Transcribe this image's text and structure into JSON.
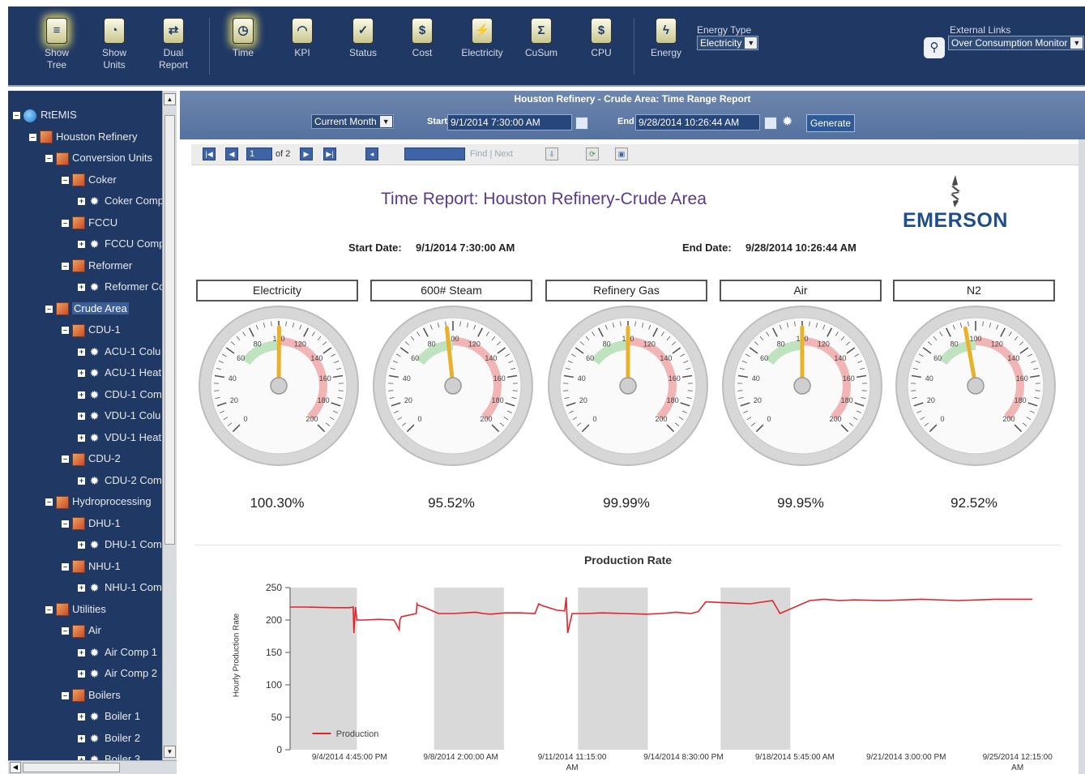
{
  "toolbar": {
    "buttons": [
      {
        "label1": "Show",
        "label2": "Tree",
        "icon": "tree-icon"
      },
      {
        "label1": "Show",
        "label2": "Units",
        "icon": "units-icon"
      },
      {
        "label1": "Dual",
        "label2": "Report",
        "icon": "dual-report-icon"
      },
      {
        "label1": "Time",
        "label2": "",
        "icon": "clock-icon"
      },
      {
        "label1": "KPI",
        "label2": "",
        "icon": "kpi-icon"
      },
      {
        "label1": "Status",
        "label2": "",
        "icon": "status-icon"
      },
      {
        "label1": "Cost",
        "label2": "",
        "icon": "dollar-icon"
      },
      {
        "label1": "Electricity",
        "label2": "",
        "icon": "plug-icon"
      },
      {
        "label1": "CuSum",
        "label2": "",
        "icon": "cusum-icon"
      },
      {
        "label1": "CPU",
        "label2": "",
        "icon": "cpu-icon"
      },
      {
        "label1": "Energy",
        "label2": "",
        "icon": "energy-icon"
      }
    ],
    "energy_type_label": "Energy Type",
    "energy_type_value": "Electricity",
    "external_links_label": "External Links",
    "external_links_value": "Over Consumption Monitor"
  },
  "tree": [
    {
      "label": "RtEMIS",
      "type": "globe",
      "toggle": "■"
    },
    {
      "label": "Houston Refinery",
      "type": "node",
      "toggle": "■"
    },
    {
      "label": "Conversion Units",
      "type": "node",
      "toggle": "■"
    },
    {
      "label": "Coker",
      "type": "node",
      "toggle": "■"
    },
    {
      "label": "Coker Comp",
      "type": "gear",
      "toggle": "+"
    },
    {
      "label": "FCCU",
      "type": "node",
      "toggle": "■"
    },
    {
      "label": "FCCU Comp",
      "type": "gear",
      "toggle": "+"
    },
    {
      "label": "Reformer",
      "type": "node",
      "toggle": "■"
    },
    {
      "label": "Reformer Co",
      "type": "gear",
      "toggle": "+"
    },
    {
      "label": "Crude Area",
      "type": "node",
      "toggle": "■",
      "selected": true
    },
    {
      "label": "CDU-1",
      "type": "node",
      "toggle": "■"
    },
    {
      "label": "ACU-1 Colu",
      "type": "gear",
      "toggle": "+"
    },
    {
      "label": "ACU-1 Heat",
      "type": "gear",
      "toggle": "+"
    },
    {
      "label": "CDU-1 Com",
      "type": "gear",
      "toggle": "+"
    },
    {
      "label": "VDU-1 Colu",
      "type": "gear",
      "toggle": "+"
    },
    {
      "label": "VDU-1 Heat",
      "type": "gear",
      "toggle": "+"
    },
    {
      "label": "CDU-2",
      "type": "node",
      "toggle": "■"
    },
    {
      "label": "CDU-2 Com",
      "type": "gear",
      "toggle": "+"
    },
    {
      "label": "Hydroprocessing",
      "type": "node",
      "toggle": "■"
    },
    {
      "label": "DHU-1",
      "type": "node",
      "toggle": "■"
    },
    {
      "label": "DHU-1 Com",
      "type": "gear",
      "toggle": "+"
    },
    {
      "label": "NHU-1",
      "type": "node",
      "toggle": "■"
    },
    {
      "label": "NHU-1 Com",
      "type": "gear",
      "toggle": "+"
    },
    {
      "label": "Utilities",
      "type": "node",
      "toggle": "■"
    },
    {
      "label": "Air",
      "type": "node",
      "toggle": "■"
    },
    {
      "label": "Air Comp 1",
      "type": "gear",
      "toggle": "+"
    },
    {
      "label": "Air Comp 2",
      "type": "gear",
      "toggle": "+"
    },
    {
      "label": "Boilers",
      "type": "node",
      "toggle": "■"
    },
    {
      "label": "Boiler 1",
      "type": "gear",
      "toggle": "+"
    },
    {
      "label": "Boiler 2",
      "type": "gear",
      "toggle": "+"
    },
    {
      "label": "Boiler 3",
      "type": "gear",
      "toggle": "+"
    }
  ],
  "header": {
    "report_title": "Houston Refinery - Crude Area: Time Range Report",
    "range_value": "Current Month",
    "start_label": "Start",
    "start_value": "9/1/2014 7:30:00 AM",
    "end_label": "End",
    "end_value": "9/28/2014 10:26:44 AM",
    "generate_label": "Generate"
  },
  "report_toolbar": {
    "page_value": "1",
    "page_of": "of 2",
    "find_next": "Find | Next"
  },
  "report": {
    "title": "Time Report: Houston Refinery-Crude Area",
    "logo_text": "EMERSON",
    "start_label": "Start Date:",
    "start_value": "9/1/2014 7:30:00 AM",
    "end_label": "End Date:",
    "end_value": "9/28/2014 10:26:44 AM",
    "gauges": [
      {
        "label": "Electricity",
        "value_text": "100.30%",
        "value": 100.3
      },
      {
        "label": "600# Steam",
        "value_text": "95.52%",
        "value": 95.52
      },
      {
        "label": "Refinery Gas",
        "value_text": "99.99%",
        "value": 99.99
      },
      {
        "label": "Air",
        "value_text": "99.95%",
        "value": 99.95
      },
      {
        "label": "N2",
        "value_text": "92.52%",
        "value": 92.52
      }
    ],
    "gauge_ticks": [
      "0",
      "20",
      "40",
      "60",
      "80",
      "100",
      "120",
      "140",
      "160",
      "180",
      "200"
    ]
  },
  "chart_data": {
    "type": "line",
    "title": "Production Rate",
    "ylabel": "Hourly Production Rate",
    "xlabel": "",
    "ylim": [
      0,
      250
    ],
    "yticks": [
      0,
      50,
      100,
      150,
      200,
      250
    ],
    "xtick_labels": [
      [
        "9/4/2014 4:45:00 PM"
      ],
      [
        "9/8/2014 2:00:00 AM"
      ],
      [
        "9/11/2014 11:15:00",
        "AM"
      ],
      [
        "9/14/2014 8:30:00 PM"
      ],
      [
        "9/18/2014 5:45:00 AM"
      ],
      [
        "9/21/2014 3:00:00 PM"
      ],
      [
        "9/25/2014 12:15:00",
        "AM"
      ]
    ],
    "shaded_bands": [
      [
        0,
        0.09
      ],
      [
        0.194,
        0.288
      ],
      [
        0.388,
        0.482
      ],
      [
        0.58,
        0.674
      ]
    ],
    "series": [
      {
        "name": "Production",
        "color": "#e0242c",
        "x": [
          0,
          0.02,
          0.06,
          0.08,
          0.085,
          0.086,
          0.088,
          0.09,
          0.1,
          0.12,
          0.14,
          0.147,
          0.148,
          0.15,
          0.17,
          0.171,
          0.172,
          0.18,
          0.2,
          0.22,
          0.25,
          0.26,
          0.27,
          0.29,
          0.31,
          0.33,
          0.335,
          0.34,
          0.36,
          0.37,
          0.372,
          0.374,
          0.38,
          0.4,
          0.42,
          0.45,
          0.48,
          0.5,
          0.52,
          0.54,
          0.55,
          0.56,
          0.6,
          0.62,
          0.65,
          0.66,
          0.7,
          0.72,
          0.74,
          0.76,
          0.8,
          0.85,
          0.9,
          0.95,
          1.0
        ],
        "y": [
          220,
          220,
          219,
          219,
          220,
          180,
          220,
          200,
          200,
          201,
          200,
          185,
          200,
          205,
          210,
          225,
          223,
          220,
          210,
          210,
          212,
          210,
          209,
          211,
          211,
          210,
          225,
          222,
          215,
          214,
          235,
          180,
          210,
          210,
          211,
          210,
          209,
          210,
          212,
          210,
          213,
          228,
          226,
          225,
          230,
          210,
          230,
          232,
          230,
          231,
          230,
          232,
          230,
          232,
          232
        ]
      }
    ],
    "legend": "bottom-left inside"
  }
}
